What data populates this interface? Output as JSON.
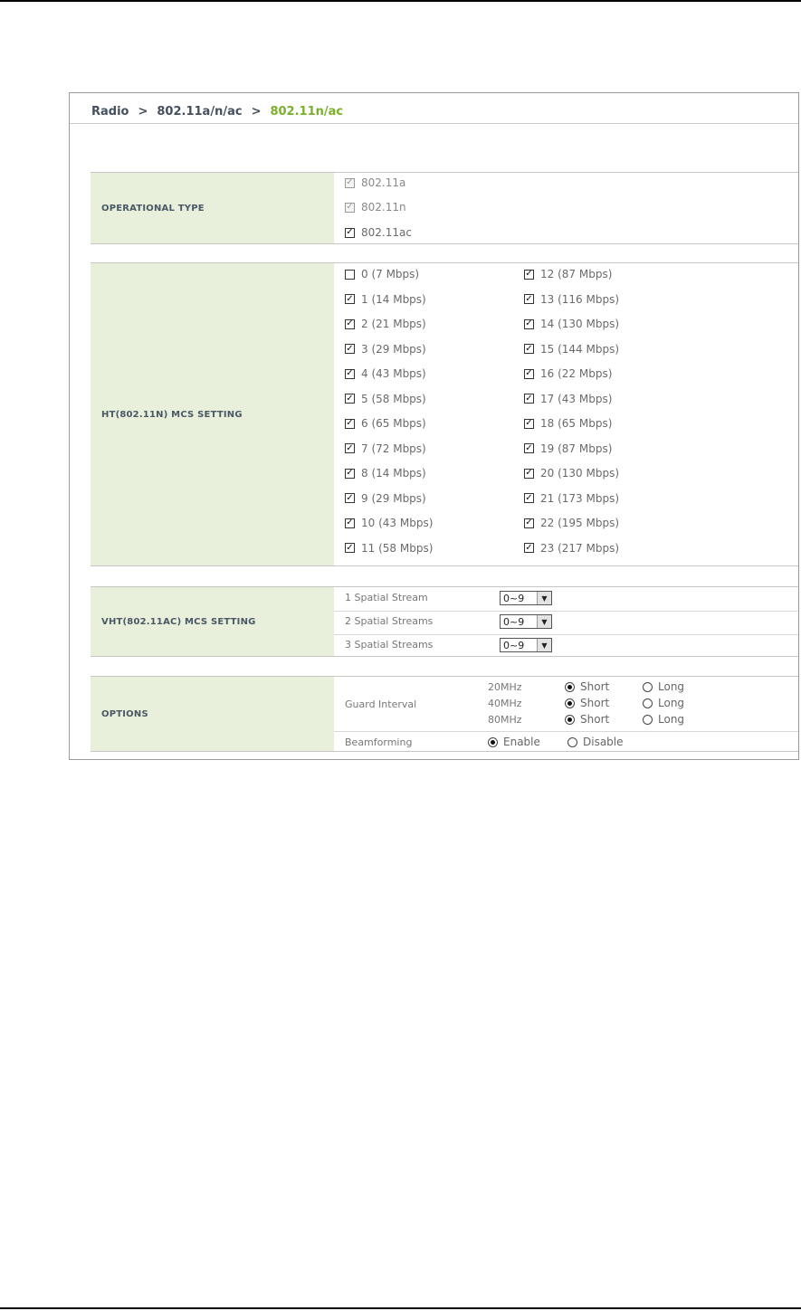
{
  "breadcrumb": {
    "items": [
      "Radio",
      "802.11a/n/ac"
    ],
    "separator": ">",
    "current": "802.11n/ac"
  },
  "colors": {
    "label_bg": "#e8f0dc",
    "current_crumb": "#7ab02c",
    "label_text": "#4a5866"
  },
  "operational_type": {
    "label": "OPERATIONAL TYPE",
    "options": [
      {
        "label": "802.11a",
        "checked": true,
        "disabled": true
      },
      {
        "label": "802.11n",
        "checked": true,
        "disabled": true
      },
      {
        "label": "802.11ac",
        "checked": true,
        "disabled": false
      }
    ]
  },
  "ht_mcs": {
    "label": "HT(802.11N) MCS SETTING",
    "col1": [
      {
        "label": "0 (7 Mbps)",
        "checked": false
      },
      {
        "label": "1 (14 Mbps)",
        "checked": true
      },
      {
        "label": "2 (21 Mbps)",
        "checked": true
      },
      {
        "label": "3 (29 Mbps)",
        "checked": true
      },
      {
        "label": "4 (43 Mbps)",
        "checked": true
      },
      {
        "label": "5 (58 Mbps)",
        "checked": true
      },
      {
        "label": "6 (65 Mbps)",
        "checked": true
      },
      {
        "label": "7 (72 Mbps)",
        "checked": true
      },
      {
        "label": "8 (14 Mbps)",
        "checked": true
      },
      {
        "label": "9 (29 Mbps)",
        "checked": true
      },
      {
        "label": "10 (43 Mbps)",
        "checked": true
      },
      {
        "label": "11 (58 Mbps)",
        "checked": true
      }
    ],
    "col2": [
      {
        "label": "12 (87 Mbps)",
        "checked": true
      },
      {
        "label": "13 (116 Mbps)",
        "checked": true
      },
      {
        "label": "14 (130 Mbps)",
        "checked": true
      },
      {
        "label": "15 (144 Mbps)",
        "checked": true
      },
      {
        "label": "16 (22 Mbps)",
        "checked": true
      },
      {
        "label": "17 (43 Mbps)",
        "checked": true
      },
      {
        "label": "18 (65 Mbps)",
        "checked": true
      },
      {
        "label": "19 (87 Mbps)",
        "checked": true
      },
      {
        "label": "20 (130 Mbps)",
        "checked": true
      },
      {
        "label": "21 (173 Mbps)",
        "checked": true
      },
      {
        "label": "22 (195 Mbps)",
        "checked": true
      },
      {
        "label": "23 (217 Mbps)",
        "checked": true
      }
    ]
  },
  "vht_mcs": {
    "label": "VHT(802.11AC) MCS SETTING",
    "rows": [
      {
        "label": "1 Spatial Stream",
        "value": "0~9"
      },
      {
        "label": "2 Spatial Streams",
        "value": "0~9"
      },
      {
        "label": "3 Spatial Streams",
        "value": "0~9"
      }
    ]
  },
  "options": {
    "label": "OPTIONS",
    "guard_interval": {
      "label": "Guard Interval",
      "rows": [
        {
          "band": "20MHz",
          "short": "Short",
          "long": "Long",
          "selected": "short"
        },
        {
          "band": "40MHz",
          "short": "Short",
          "long": "Long",
          "selected": "short"
        },
        {
          "band": "80MHz",
          "short": "Short",
          "long": "Long",
          "selected": "short"
        }
      ]
    },
    "beamforming": {
      "label": "Beamforming",
      "enable": "Enable",
      "disable": "Disable",
      "selected": "enable"
    }
  }
}
